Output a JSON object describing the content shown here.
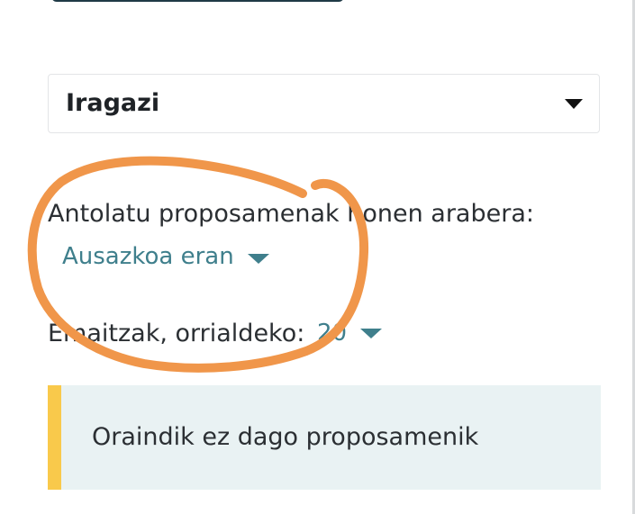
{
  "filter": {
    "label": "Iragazi"
  },
  "order": {
    "label": "Antolatu proposamenak honen arabera:",
    "value": "Ausazkoa eran"
  },
  "per_page": {
    "label": "Emaitzak, orrialdeko:",
    "value": "20"
  },
  "callout": {
    "text": "Oraindik ez dago proposamenik"
  },
  "colors": {
    "accent_link": "#3f7f8c",
    "callout_bg": "#e9f2f3",
    "callout_border": "#f9c94b",
    "annotation_stroke": "#f0964a"
  },
  "icons": {
    "filter_caret": "caret-down-icon",
    "order_caret": "caret-down-icon",
    "per_page_caret": "caret-down-icon"
  }
}
